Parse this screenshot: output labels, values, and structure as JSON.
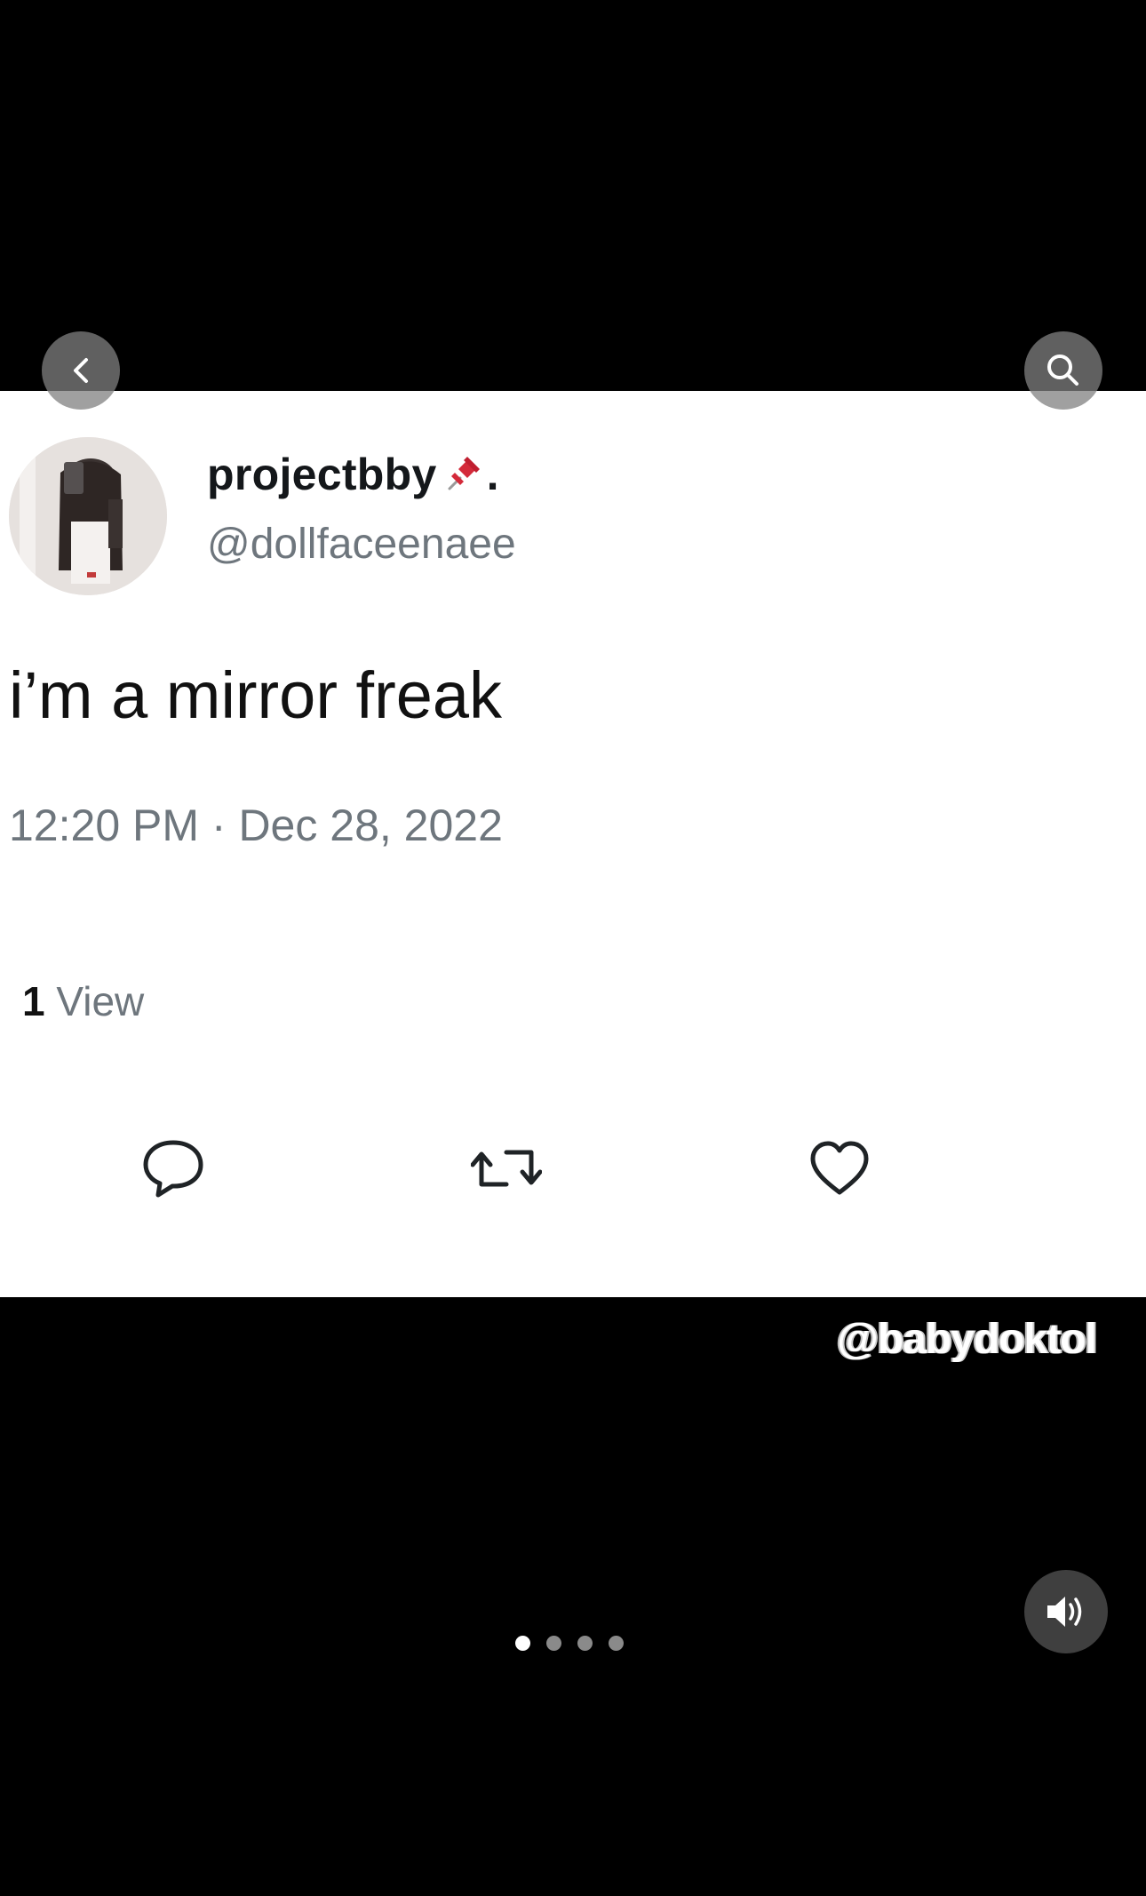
{
  "tweet": {
    "display_name": "projectbby",
    "name_suffix": ".",
    "handle": "@dollfaceenaee",
    "text": "i’m a mirror freak",
    "timestamp": "12:20 PM · Dec 28, 2022",
    "views_count": "1",
    "views_label": "View"
  },
  "icons": {
    "back": "chevron-left-icon",
    "search": "search-icon",
    "pin": "pushpin-icon",
    "reply": "speech-bubble-icon",
    "retweet": "retweet-icon",
    "like": "heart-icon",
    "sound": "speaker-icon"
  },
  "watermark": "@babydoktol",
  "carousel": {
    "total": 4,
    "active_index": 0
  },
  "colors": {
    "background": "#000000",
    "card": "#ffffff",
    "secondary_text": "#6e767d",
    "pin_red": "#d42a3a"
  }
}
